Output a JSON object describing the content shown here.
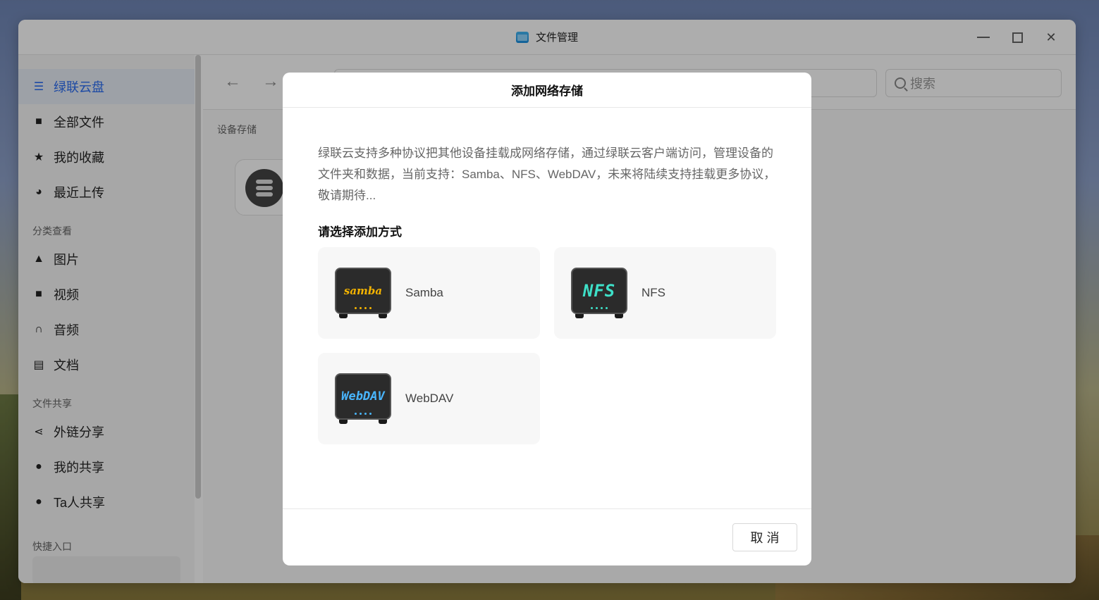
{
  "window": {
    "title": "文件管理"
  },
  "sidebar": {
    "items_top": [
      {
        "label": "绿联云盘",
        "icon": "storage-icon",
        "active": true
      },
      {
        "label": "全部文件",
        "icon": "folder-icon"
      },
      {
        "label": "我的收藏",
        "icon": "star-icon"
      },
      {
        "label": "最近上传",
        "icon": "clock-icon"
      }
    ],
    "section_category": "分类查看",
    "items_category": [
      {
        "label": "图片",
        "icon": "image-icon"
      },
      {
        "label": "视频",
        "icon": "video-icon"
      },
      {
        "label": "音频",
        "icon": "headphones-icon"
      },
      {
        "label": "文档",
        "icon": "document-icon"
      }
    ],
    "section_share": "文件共享",
    "items_share": [
      {
        "label": "外链分享",
        "icon": "share-icon"
      },
      {
        "label": "我的共享",
        "icon": "user-share-icon"
      },
      {
        "label": "Ta人共享",
        "icon": "users-icon"
      }
    ],
    "section_quick": "快捷入口"
  },
  "toolbar": {
    "search_placeholder": "搜索"
  },
  "main": {
    "breadcrumb": "设备存储"
  },
  "modal": {
    "title": "添加网络存储",
    "description": "绿联云支持多种协议把其他设备挂载成网络存储，通过绿联云客户端访问，管理设备的文件夹和数据，当前支持：Samba、NFS、WebDAV，未来将陆续支持挂载更多协议，敬请期待...",
    "subtitle": "请选择添加方式",
    "protocols": [
      {
        "label": "Samba",
        "logo": "samba"
      },
      {
        "label": "NFS",
        "logo": "NFS"
      },
      {
        "label": "WebDAV",
        "logo": "WebDAV"
      }
    ],
    "cancel_label": "取 消"
  },
  "colors": {
    "accent": "#2c6ef2",
    "samba_logo": "#f5b400",
    "nfs_logo": "#3ee0c8",
    "webdav_logo": "#49b6ff"
  }
}
